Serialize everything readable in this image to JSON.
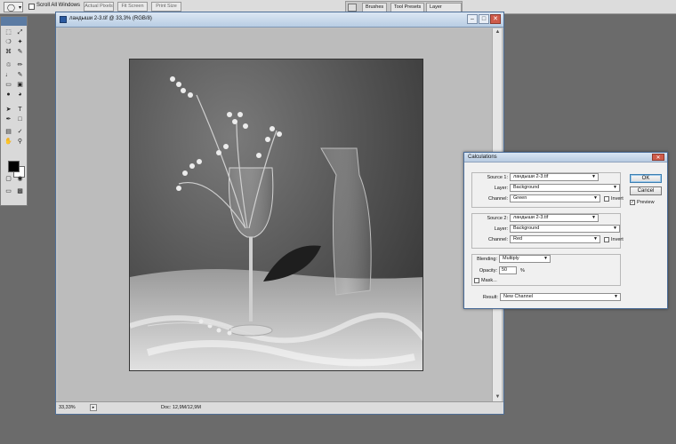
{
  "options_bar": {
    "tool_icon": "zoom-icon",
    "scroll_all_windows_label": "Scroll All Windows",
    "scroll_all_windows_checked": false,
    "actual_pixels_label": "Actual Pixels",
    "fit_screen_label": "Fit Screen",
    "print_size_label": "Print Size",
    "panel_tabs": [
      "Brushes",
      "Tool Presets",
      "Layer Comps"
    ]
  },
  "toolbox": {
    "tools": [
      "marquee-icon",
      "move-icon",
      "lasso-icon",
      "magic-wand-icon",
      "crop-icon",
      "slice-icon",
      "healing-brush-icon",
      "brush-icon",
      "clone-stamp-icon",
      "history-brush-icon",
      "eraser-icon",
      "gradient-icon",
      "blur-icon",
      "dodge-icon",
      "pen-icon",
      "type-icon",
      "path-selection-icon",
      "shape-icon",
      "notes-icon",
      "eyedropper-icon",
      "hand-icon",
      "zoom-icon"
    ],
    "foreground_color": "#000000",
    "background_color": "#ffffff"
  },
  "document": {
    "title": "ландыши 2-3.tif @ 33,3% (RGB/8)",
    "zoom": "33,33%",
    "doc_info": "Doc: 12,9M/12,9M"
  },
  "calculations": {
    "title": "Calculations",
    "source1": {
      "label": "Source 1:",
      "file": "ландыши 2-3.tif",
      "layer_label": "Layer:",
      "layer": "Background",
      "channel_label": "Channel:",
      "channel": "Green",
      "invert_label": "Invert",
      "invert": false
    },
    "source2": {
      "label": "Source 2:",
      "file": "ландыши 2-3.tif",
      "layer_label": "Layer:",
      "layer": "Background",
      "channel_label": "Channel:",
      "channel": "Red",
      "invert_label": "Invert",
      "invert": false
    },
    "blending_label": "Blending:",
    "blending": "Multiply",
    "opacity_label": "Opacity:",
    "opacity": "50",
    "opacity_unit": "%",
    "mask_label": "Mask...",
    "mask": false,
    "result_label": "Result:",
    "result": "New Channel",
    "ok_label": "OK",
    "cancel_label": "Cancel",
    "preview_label": "Preview",
    "preview": true
  },
  "colors": {
    "workspace": "#6b6b6b",
    "title_bar": "#b9cde3",
    "accent": "#3c7fb1"
  }
}
